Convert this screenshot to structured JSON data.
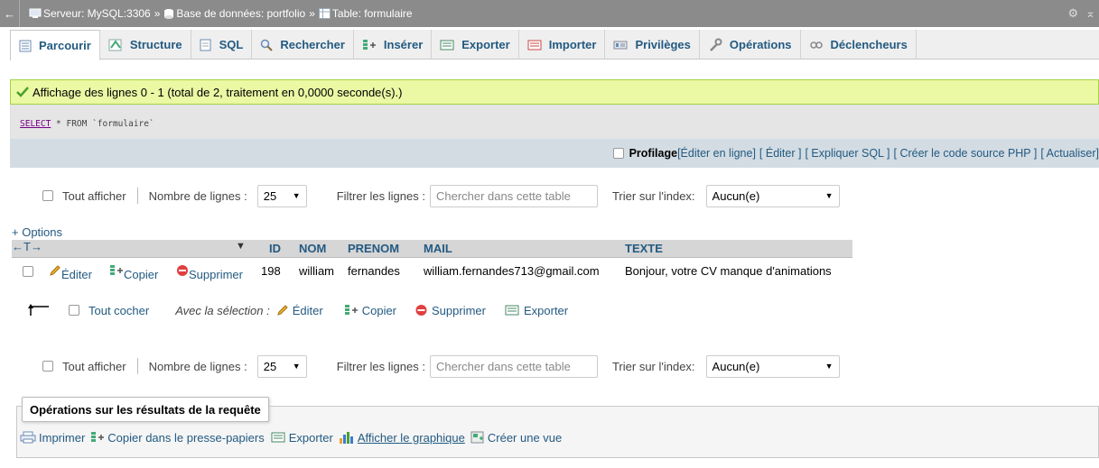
{
  "breadcrumb": {
    "server": "Serveur: MySQL:3306",
    "database": "Base de données: portfolio",
    "table": "Table: formulaire",
    "separator": "»"
  },
  "tabs": [
    {
      "label": "Parcourir",
      "icon": "browse-icon"
    },
    {
      "label": "Structure",
      "icon": "structure-icon"
    },
    {
      "label": "SQL",
      "icon": "sql-icon"
    },
    {
      "label": "Rechercher",
      "icon": "search-icon"
    },
    {
      "label": "Insérer",
      "icon": "insert-icon"
    },
    {
      "label": "Exporter",
      "icon": "export-icon"
    },
    {
      "label": "Importer",
      "icon": "import-icon"
    },
    {
      "label": "Privilèges",
      "icon": "privileges-icon"
    },
    {
      "label": "Opérations",
      "icon": "wrench-icon"
    },
    {
      "label": "Déclencheurs",
      "icon": "triggers-icon"
    }
  ],
  "success_message": "Affichage des lignes 0 - 1 (total de 2, traitement en 0,0000 seconde(s).)",
  "query": {
    "keyword": "SELECT",
    "rest": " * FROM `formulaire`"
  },
  "query_actions": {
    "profiling": "Profilage",
    "edit_inline": "[Éditer en ligne]",
    "edit": "[ Éditer ]",
    "explain": "[ Expliquer SQL ]",
    "php_code": "[ Créer le code source PHP ]",
    "refresh": "[ Actualiser]"
  },
  "nav": {
    "show_all": "Tout afficher",
    "rows_label": "Nombre de lignes :",
    "rows_value": "25",
    "filter_label": "Filtrer les lignes :",
    "filter_placeholder": "Chercher dans cette table",
    "sort_label": "Trier sur l'index:",
    "sort_value": "Aucun(e)"
  },
  "options_link": "+ Options",
  "columns": {
    "id": "ID",
    "nom": "NOM",
    "prenom": "PRENOM",
    "mail": "MAIL",
    "texte": "TEXTE"
  },
  "row_actions": {
    "edit": "Éditer",
    "copy": "Copier",
    "delete": "Supprimer"
  },
  "rows": [
    {
      "id": "198",
      "nom": "william",
      "prenom": "fernandes",
      "mail": "william.fernandes713@gmail.com",
      "texte": "Bonjour, votre CV manque d'animations"
    }
  ],
  "selection": {
    "check_all": "Tout cocher",
    "with_selection": "Avec la sélection :",
    "edit": "Éditer",
    "copy": "Copier",
    "delete": "Supprimer",
    "export": "Exporter"
  },
  "query_ops": {
    "legend": "Opérations sur les résultats de la requête",
    "print": "Imprimer",
    "copy_clipboard": "Copier dans le presse-papiers",
    "export": "Exporter",
    "chart": "Afficher le graphique",
    "create_view": "Créer une vue"
  }
}
